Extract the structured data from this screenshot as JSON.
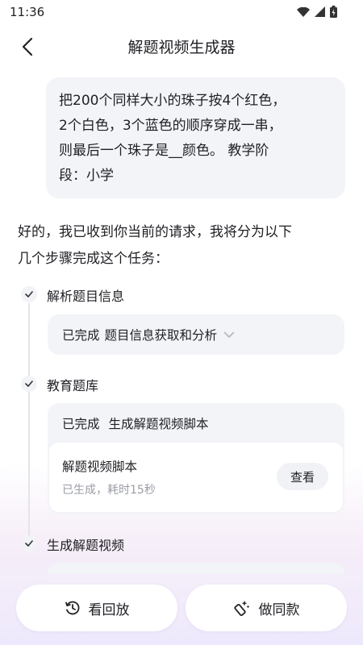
{
  "status_bar": {
    "time": "11:36",
    "icons": [
      "wifi-icon",
      "cellular-signal-icon",
      "battery-charging-icon"
    ]
  },
  "header": {
    "title": "解题视频生成器",
    "back_icon": "chevron-left-icon"
  },
  "user_message": {
    "lines": [
      "把200个同样大小的珠子按4个红色，",
      "2个白色，3个蓝色的顺序穿成一串，",
      "则最后一个珠子是__颜色。 教学阶",
      "段：小学"
    ]
  },
  "reply": {
    "lines": [
      "好的，我已收到你当前的请求，我将分为以下",
      "几个步骤完成这个任务："
    ]
  },
  "steps": [
    {
      "title": "解析题目信息",
      "card": {
        "status": "已完成",
        "text": "题目信息获取和分析",
        "expand_icon": "chevron-down-icon"
      }
    },
    {
      "title": "教育题库",
      "card": {
        "status": "已完成",
        "text": "生成解题视频脚本",
        "item": {
          "title": "解题视频脚本",
          "subtitle": "已生成，耗时15秒",
          "action": "查看"
        }
      }
    },
    {
      "title": "生成解题视频"
    }
  ],
  "bottom_bar": {
    "replay": {
      "label": "看回放",
      "icon": "history-icon"
    },
    "make_same": {
      "label": "做同款",
      "icon": "magic-wand-icon"
    }
  },
  "colors": {
    "card_bg": "#f3f4f8",
    "text": "#1f1f24",
    "muted": "#9a9ca6",
    "gradient_end": "#ece6fb"
  }
}
